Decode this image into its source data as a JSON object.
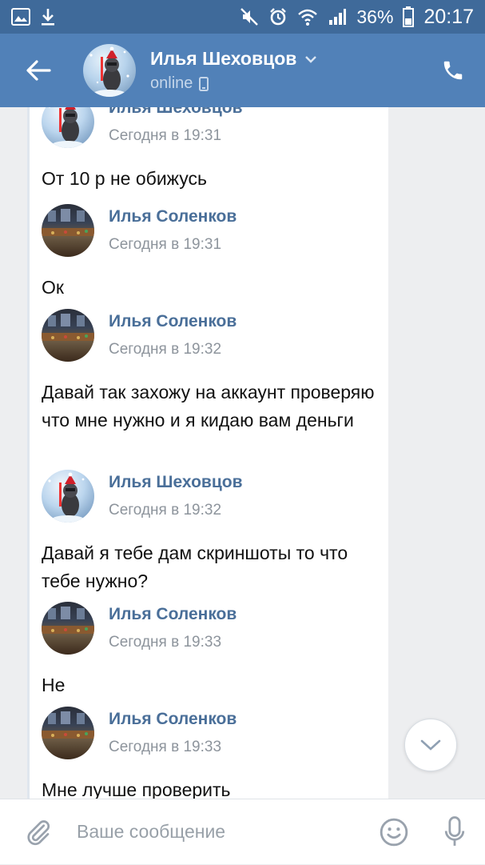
{
  "status_bar": {
    "battery": "36%",
    "time": "20:17",
    "icons": [
      "gallery-icon",
      "download-icon",
      "mute-icon",
      "alarm-icon",
      "wifi-icon",
      "signal-icon",
      "battery-icon"
    ]
  },
  "header": {
    "title": "Илья Шеховцов",
    "status": "online",
    "icons": [
      "back-arrow-icon",
      "chevron-down-icon",
      "phone-icon",
      "mobile-device-icon"
    ]
  },
  "messages": [
    {
      "author": "Илья Шеховцов",
      "time": "Сегодня в 19:31",
      "text": "От 10 р не обижусь"
    },
    {
      "author": "Илья Соленков",
      "time": "Сегодня в 19:31",
      "text": "Ок"
    },
    {
      "author": "Илья Соленков",
      "time": "Сегодня в 19:32",
      "text": "Давай так захожу на аккаунт проверяю что мне нужно и я кидаю  вам деньги"
    },
    {
      "author": "Илья Шеховцов",
      "time": "Сегодня в 19:32",
      "text": "Давай я тебе дам скриншоты то что тебе нужно?"
    },
    {
      "author": "Илья Соленков",
      "time": "Сегодня в 19:33",
      "text": "Не"
    },
    {
      "author": "Илья Соленков",
      "time": "Сегодня в 19:33",
      "text": "Мне лучше проверить"
    }
  ],
  "composer": {
    "placeholder": "Ваше сообщение",
    "value": "",
    "icons": [
      "attach-icon",
      "emoji-icon",
      "mic-icon"
    ]
  },
  "colors": {
    "status_bar": "#3f6a9a",
    "header": "#5181b8",
    "author_name": "#4a6f99",
    "timestamp": "#8d949c"
  }
}
